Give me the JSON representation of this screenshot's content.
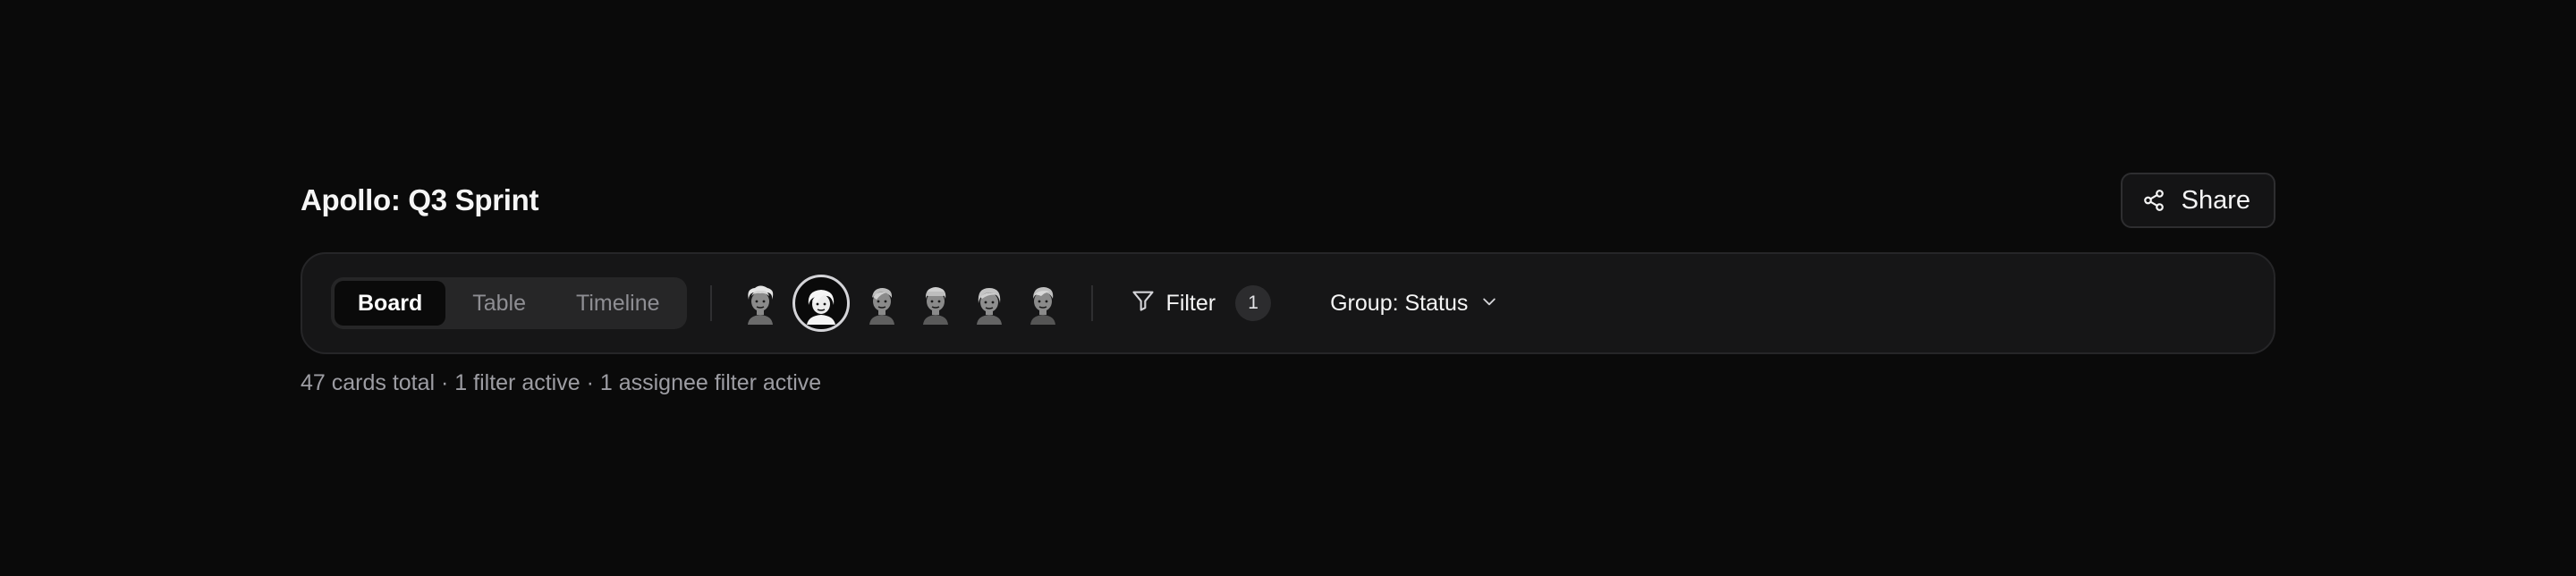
{
  "header": {
    "title": "Apollo: Q3 Sprint",
    "share_label": "Share",
    "share_icon": "share-nodes-icon"
  },
  "toolbar": {
    "views": [
      {
        "label": "Board",
        "active": true
      },
      {
        "label": "Table",
        "active": false
      },
      {
        "label": "Timeline",
        "active": false
      }
    ],
    "assignees": [
      {
        "icon": "avatar-person-icon",
        "selected": false
      },
      {
        "icon": "avatar-person-icon",
        "selected": true
      },
      {
        "icon": "avatar-person-icon",
        "selected": false
      },
      {
        "icon": "avatar-person-icon",
        "selected": false
      },
      {
        "icon": "avatar-person-icon",
        "selected": false
      },
      {
        "icon": "avatar-person-icon",
        "selected": false
      }
    ],
    "filter": {
      "label": "Filter",
      "count": "1",
      "icon": "funnel-icon"
    },
    "group": {
      "label": "Group: Status",
      "icon": "chevron-down-icon"
    }
  },
  "status": {
    "summary": "47 cards total · 1 filter active · 1 assignee filter active"
  },
  "colors": {
    "background": "#0a0a0a",
    "toolbar_bg": "#161617",
    "text_primary": "#f5f5f5",
    "text_muted": "#9d9da3"
  }
}
